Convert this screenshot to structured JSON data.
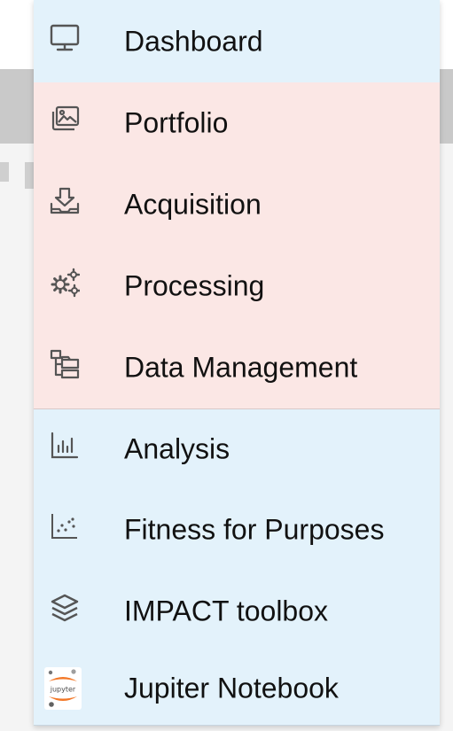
{
  "menu": {
    "items": [
      {
        "label": "Dashboard",
        "icon": "monitor-icon",
        "active": false
      },
      {
        "label": "Portfolio",
        "icon": "image-gallery-icon",
        "active": true
      },
      {
        "label": "Acquisition",
        "icon": "download-tray-icon",
        "active": true
      },
      {
        "label": "Processing",
        "icon": "gears-icon",
        "active": true
      },
      {
        "label": "Data Management",
        "icon": "folder-tree-icon",
        "active": true
      },
      {
        "label": "Analysis",
        "icon": "bar-chart-icon",
        "active": false
      },
      {
        "label": "Fitness for Purposes",
        "icon": "scatter-chart-icon",
        "active": false
      },
      {
        "label": "IMPACT toolbox",
        "icon": "layers-icon",
        "active": false
      },
      {
        "label": "Jupiter Notebook",
        "icon": "jupyter-logo-icon",
        "active": false
      }
    ],
    "jupyter_logo_text": "jupyter"
  },
  "colors": {
    "menu_bg": "#e3f2fb",
    "active_bg": "#fbe7e5",
    "icon_stroke": "#555555",
    "jupyter_orange": "#f37726"
  }
}
